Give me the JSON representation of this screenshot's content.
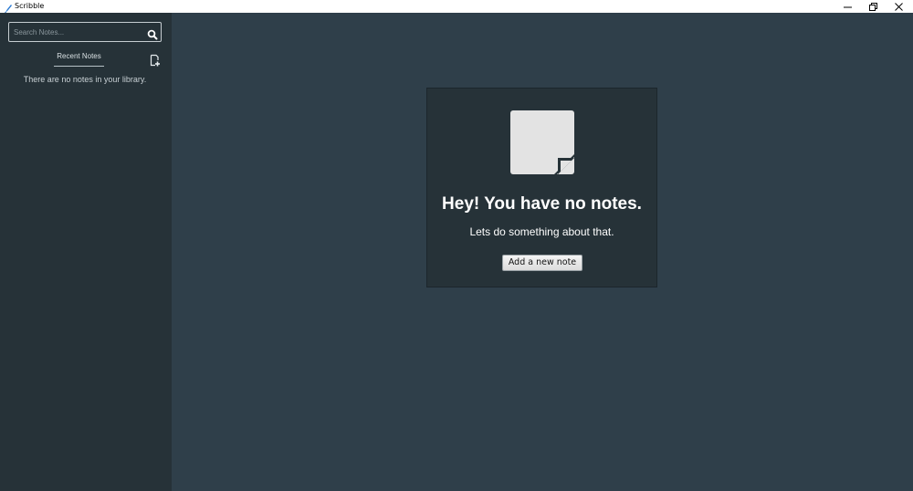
{
  "window": {
    "title": "Scribble",
    "controls": [
      "minimize-icon",
      "restore-icon",
      "close-icon"
    ]
  },
  "sidebar": {
    "search": {
      "placeholder": "Search Notes...",
      "value": "",
      "icon": "search-icon"
    },
    "recent_tab_label": "Recent Notes",
    "new_note_icon": "new-note-icon",
    "empty_message": "There are no notes in your library."
  },
  "main": {
    "empty_state": {
      "icon": "note-icon",
      "heading": "Hey! You have no notes.",
      "subheading": "Lets do something about that.",
      "button_label": "Add a new note"
    }
  },
  "colors": {
    "sidebar_bg": "#263238",
    "main_bg": "#2f3f4a",
    "card_bg": "#263238",
    "note_icon": "#e3e3e3"
  }
}
